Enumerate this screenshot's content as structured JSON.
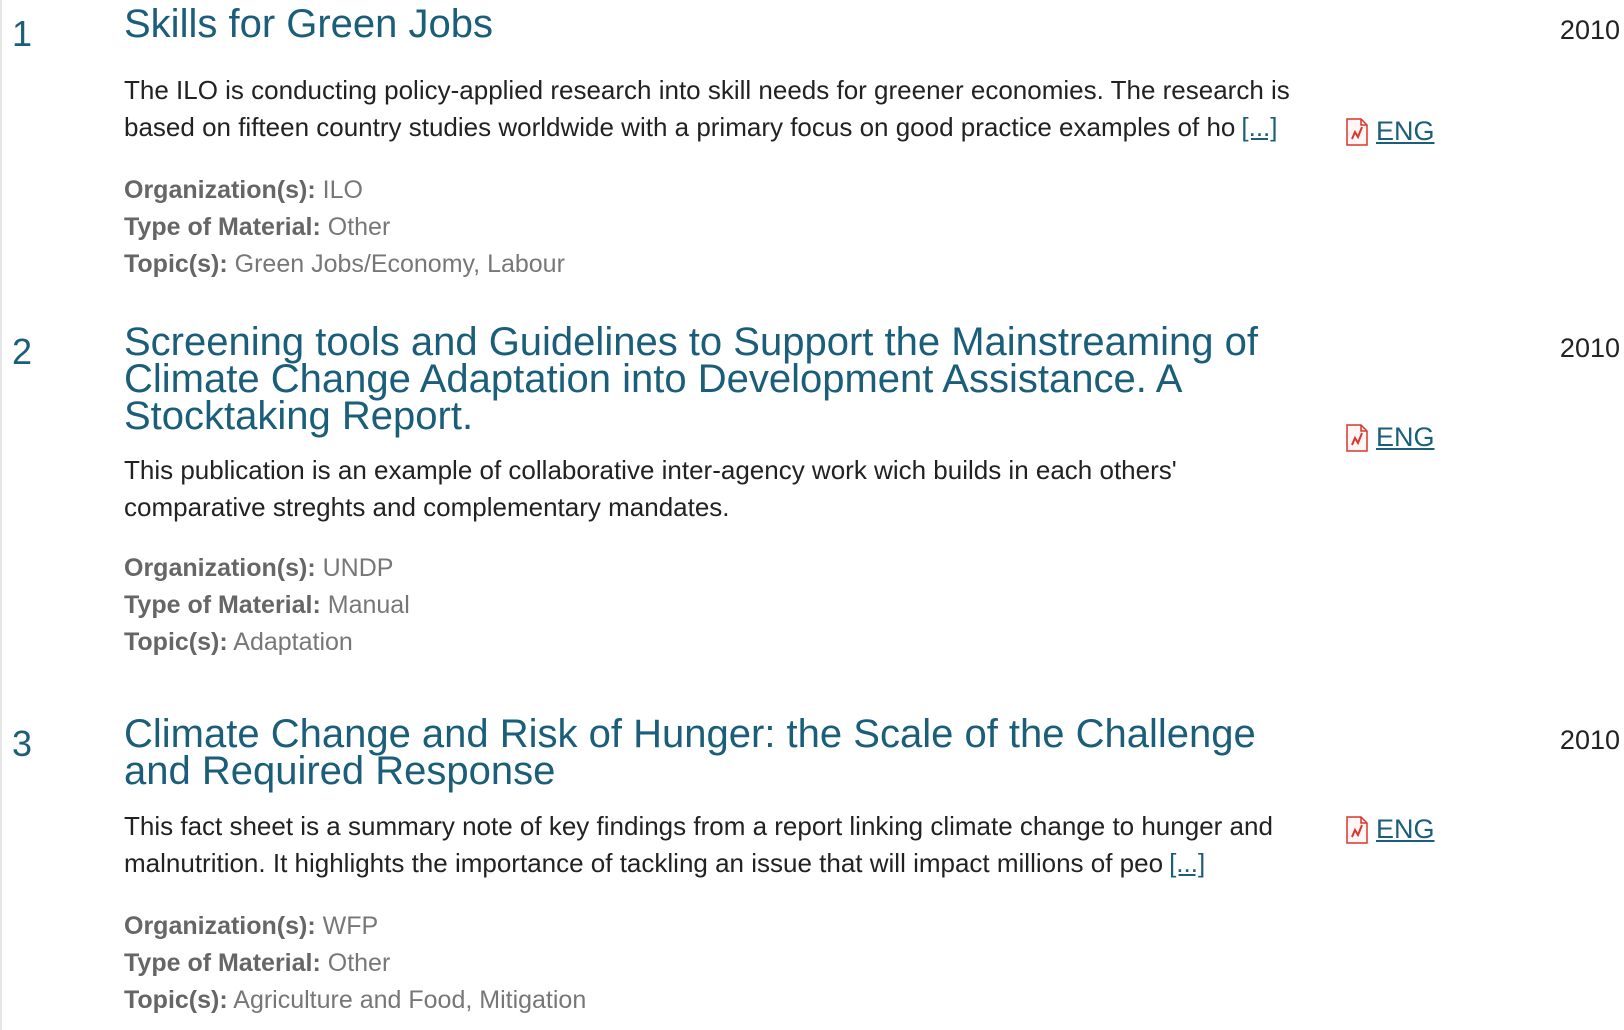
{
  "results": [
    {
      "number": "1",
      "title": "Skills for Green Jobs",
      "year": "2010",
      "description": "The ILO is conducting policy-applied research into skill needs for greener economies. The research is based on fifteen country studies worldwide with a primary focus on good practice examples of ho",
      "more_label": "[...]",
      "download_label": "ENG",
      "organization_label": "Organization(s):",
      "organization": "ILO",
      "type_label": "Type of Material:",
      "type": "Other",
      "topics_label": "Topic(s):",
      "topics": "Green Jobs/Economy, Labour"
    },
    {
      "number": "2",
      "title": "Screening tools and Guidelines to Support the Mainstreaming of Climate Change Adaptation into Development Assistance. A Stocktaking Report.",
      "year": "2010",
      "description": "This publication is an example of collaborative inter-agency work wich builds in each others' comparative streghts and complementary mandates.",
      "more_label": "",
      "download_label": "ENG",
      "organization_label": "Organization(s):",
      "organization": "UNDP",
      "type_label": "Type of Material:",
      "type": "Manual",
      "topics_label": "Topic(s):",
      "topics": "Adaptation"
    },
    {
      "number": "3",
      "title": "Climate Change and Risk of Hunger: the Scale of the Challenge and Required Response",
      "year": "2010",
      "description": "This fact sheet is a summary note of key findings from a report linking climate change to hunger and malnutrition. It highlights the importance of tackling an issue that will impact millions of peo",
      "more_label": "[...]",
      "download_label": "ENG",
      "organization_label": "Organization(s):",
      "organization": "WFP",
      "type_label": "Type of Material:",
      "type": "Other",
      "topics_label": "Topic(s):",
      "topics": "Agriculture and Food, Mitigation"
    }
  ],
  "colors": {
    "link": "#1a5e7a",
    "text": "#222222",
    "meta": "#777777",
    "pdf_icon": "#d9362b"
  },
  "icons": {
    "download": "pdf-file-icon"
  }
}
